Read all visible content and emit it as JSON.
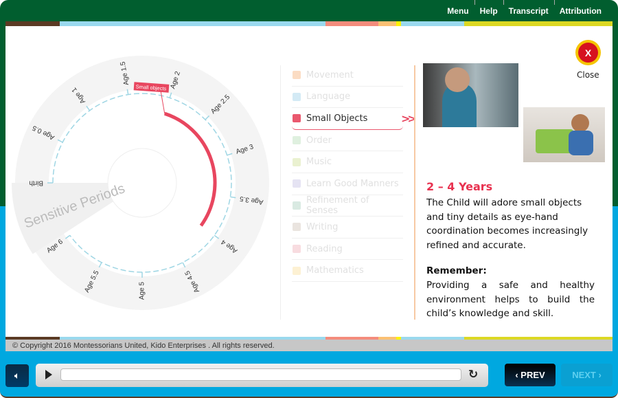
{
  "topnav": {
    "menu": "Menu",
    "help": "Help",
    "transcript": "Transcript",
    "attribution": "Attribution"
  },
  "stripe_colors": [
    "#5b3a24",
    "#9ad9ee",
    "#f48c7c",
    "#fbc073",
    "#fff200",
    "#9ad9ee",
    "#dcd823"
  ],
  "wheel": {
    "title": "Sensitive Periods",
    "ages": [
      "Birth",
      "Age 0.5",
      "Age 1",
      "Age 1.5",
      "Age 2",
      "Age 2.5",
      "Age 3",
      "Age 3.5",
      "Age 4",
      "Age 4.5",
      "Age 5",
      "Age 5.5",
      "Age 6"
    ],
    "highlight_label": "Small objects",
    "highlight_range_years": [
      2,
      4
    ],
    "highlight_color": "#e8465f"
  },
  "menu": {
    "items": [
      {
        "label": "Movement",
        "color": "#fbd9bd",
        "active": false
      },
      {
        "label": "Language",
        "color": "#cfe8f5",
        "active": false
      },
      {
        "label": "Small Objects",
        "color": "#e8465f",
        "active": true
      },
      {
        "label": "Order",
        "color": "#dcefdc",
        "active": false
      },
      {
        "label": "Music",
        "color": "#e8f0cc",
        "active": false
      },
      {
        "label": "Learn Good Manners",
        "color": "#e3e0f2",
        "active": false
      },
      {
        "label": "Refinement of Senses",
        "color": "#d5e8df",
        "active": false
      },
      {
        "label": "Writing",
        "color": "#e8e2dc",
        "active": false
      },
      {
        "label": "Reading",
        "color": "#f8d9dd",
        "active": false
      },
      {
        "label": "Mathematics",
        "color": "#fdf0cf",
        "active": false
      }
    ]
  },
  "close": {
    "icon": "X",
    "label": "Close"
  },
  "detail": {
    "years": "2 – 4 Years",
    "description": "The Child will adore small objects and tiny details as eye-hand coordination becomes increasingly refined and accurate.",
    "remember_title": "Remember:",
    "remember_text": "Providing a safe and healthy environment helps to build the child’s knowledge and skill."
  },
  "copyright": "© Copyright 2016  Montessorians United, Kido Enterprises . All rights reserved.",
  "player": {
    "prev": "‹ PREV",
    "next": "NEXT ›",
    "progress": 0
  }
}
